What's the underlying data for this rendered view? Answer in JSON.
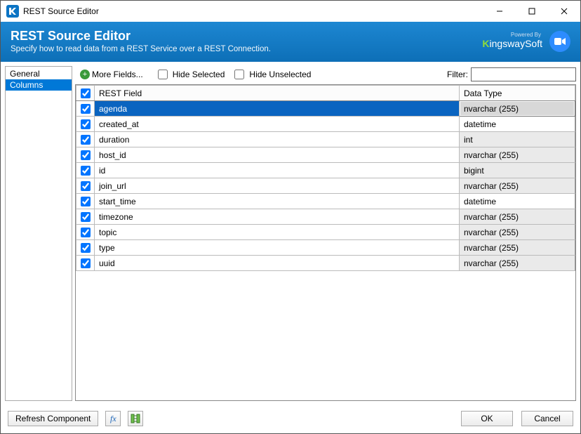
{
  "window": {
    "title": "REST Source Editor"
  },
  "header": {
    "title": "REST Source Editor",
    "subtitle": "Specify how to read data from a REST Service over a REST Connection.",
    "powered_by": "Powered By",
    "brand_k": "K",
    "brand_rest": "ingswaySoft"
  },
  "sidebar": {
    "items": [
      {
        "label": "General",
        "selected": false
      },
      {
        "label": "Columns",
        "selected": true
      }
    ]
  },
  "toolbar": {
    "more_fields": "More Fields...",
    "hide_selected": "Hide Selected",
    "hide_unselected": "Hide Unselected",
    "filter_label": "Filter:",
    "filter_value": ""
  },
  "grid": {
    "headers": {
      "field": "REST Field",
      "type": "Data Type"
    },
    "rows": [
      {
        "checked": true,
        "field": "agenda",
        "type": "nvarchar (255)",
        "type_editable": false,
        "selected": true
      },
      {
        "checked": true,
        "field": "created_at",
        "type": "datetime",
        "type_editable": true,
        "selected": false
      },
      {
        "checked": true,
        "field": "duration",
        "type": "int",
        "type_editable": false,
        "selected": false
      },
      {
        "checked": true,
        "field": "host_id",
        "type": "nvarchar (255)",
        "type_editable": false,
        "selected": false
      },
      {
        "checked": true,
        "field": "id",
        "type": "bigint",
        "type_editable": false,
        "selected": false
      },
      {
        "checked": true,
        "field": "join_url",
        "type": "nvarchar (255)",
        "type_editable": false,
        "selected": false
      },
      {
        "checked": true,
        "field": "start_time",
        "type": "datetime",
        "type_editable": true,
        "selected": false
      },
      {
        "checked": true,
        "field": "timezone",
        "type": "nvarchar (255)",
        "type_editable": false,
        "selected": false
      },
      {
        "checked": true,
        "field": "topic",
        "type": "nvarchar (255)",
        "type_editable": false,
        "selected": false
      },
      {
        "checked": true,
        "field": "type",
        "type": "nvarchar (255)",
        "type_editable": false,
        "selected": false
      },
      {
        "checked": true,
        "field": "uuid",
        "type": "nvarchar (255)",
        "type_editable": false,
        "selected": false
      }
    ]
  },
  "footer": {
    "refresh": "Refresh Component",
    "ok": "OK",
    "cancel": "Cancel"
  }
}
